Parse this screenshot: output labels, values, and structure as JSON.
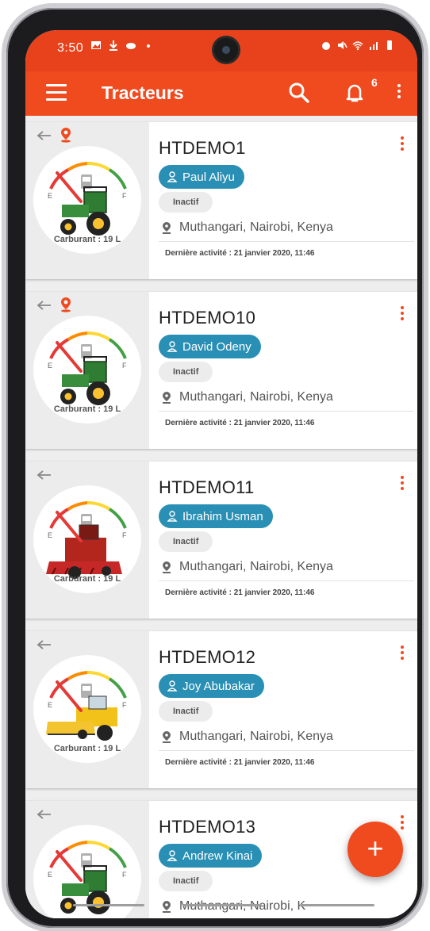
{
  "status_bar": {
    "time": "3:50"
  },
  "app_bar": {
    "title": "Tracteurs",
    "notification_count": "6"
  },
  "colors": {
    "primary": "#f04a1f",
    "driver_chip": "#2a8fb4",
    "gauge_needle": "#e53935"
  },
  "cards": [
    {
      "name": "HTDEMO1",
      "driver": "Paul Aliyu",
      "status": "Inactif",
      "location": "Muthangari, Nairobi, Kenya",
      "last_activity": "Dernière activité : 21 janvier 2020, 11:46",
      "fuel": "Carburant : 19 L",
      "machine": "tractor",
      "has_location_pin": true
    },
    {
      "name": "HTDEMO10",
      "driver": "David Odeny",
      "status": "Inactif",
      "location": "Muthangari, Nairobi, Kenya",
      "last_activity": "Dernière activité : 21 janvier 2020, 11:46",
      "fuel": "Carburant : 19 L",
      "machine": "tractor",
      "has_location_pin": true
    },
    {
      "name": "HTDEMO11",
      "driver": "Ibrahim Usman",
      "status": "Inactif",
      "location": "Muthangari, Nairobi, Kenya",
      "last_activity": "Dernière activité : 21 janvier 2020, 11:46",
      "fuel": "Carburant : 19 L",
      "machine": "red-harvester",
      "has_location_pin": false
    },
    {
      "name": "HTDEMO12",
      "driver": "Joy Abubakar",
      "status": "Inactif",
      "location": "Muthangari, Nairobi, Kenya",
      "last_activity": "Dernière activité : 21 janvier 2020, 11:46",
      "fuel": "Carburant : 19 L",
      "machine": "yellow-harvester",
      "has_location_pin": false
    },
    {
      "name": "HTDEMO13",
      "driver": "Andrew Kinai",
      "status": "Inactif",
      "location": "Muthangari, Nairobi, K",
      "last_activity": "",
      "fuel": "",
      "machine": "tractor",
      "has_location_pin": false
    }
  ],
  "fab": {
    "label": "+"
  }
}
